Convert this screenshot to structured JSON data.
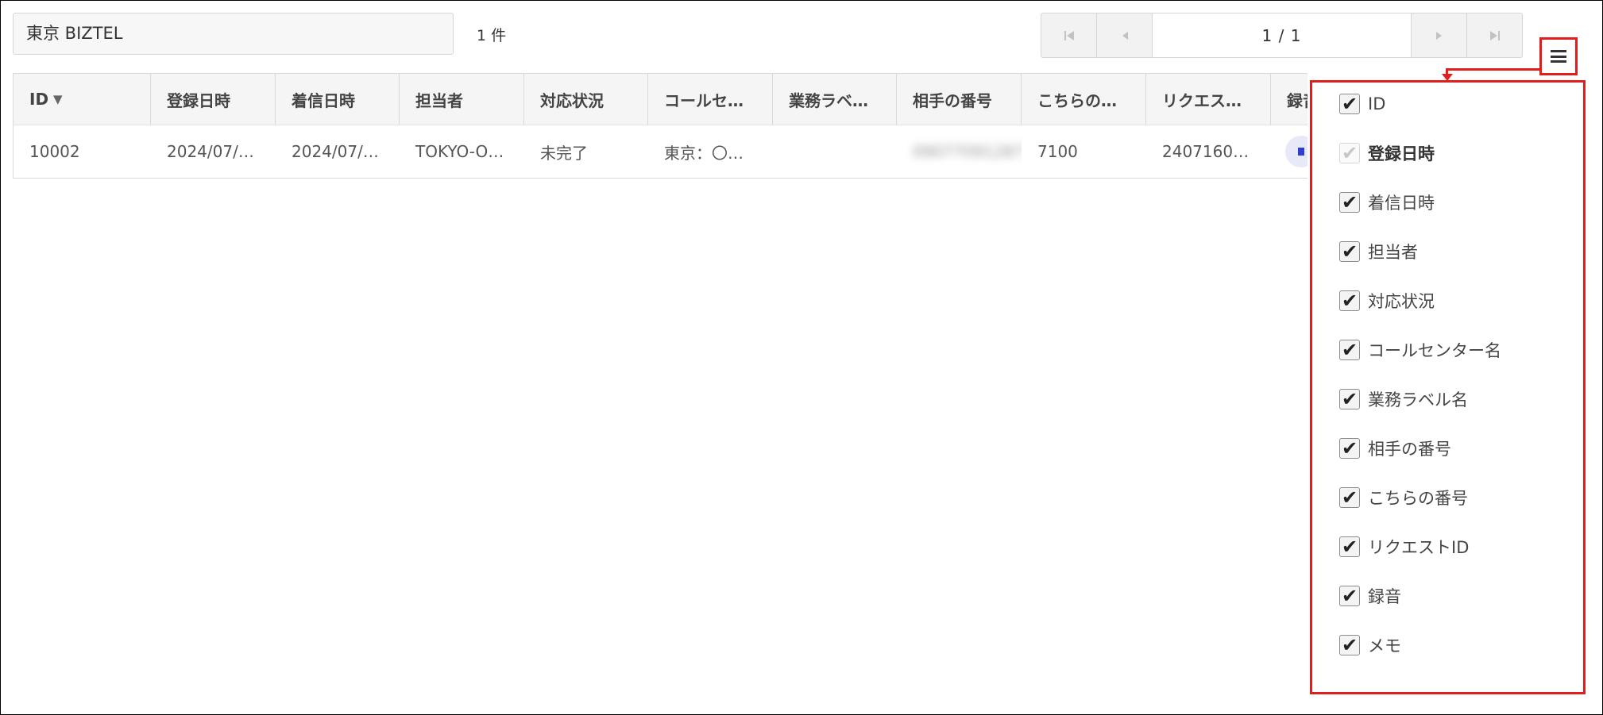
{
  "search": {
    "value": "東京 BIZTEL"
  },
  "result_count": "1 件",
  "pager": {
    "page_info": "1 / 1",
    "first_icon": "first-page-icon",
    "prev_icon": "prev-page-icon",
    "next_icon": "next-page-icon",
    "last_icon": "last-page-icon"
  },
  "table": {
    "columns": [
      "ID",
      "登録日時",
      "着信日時",
      "担当者",
      "対応状況",
      "コールセ…",
      "業務ラベ…",
      "相手の番号",
      "こちらの…",
      "リクエス…",
      "録音"
    ],
    "sort_icon": "sort-desc-icon",
    "rows": [
      {
        "cells": [
          "10002",
          "2024/07/…",
          "2024/07/…",
          "TOKYO-O…",
          "未完了",
          "東京：〇…",
          "",
          "09077091287",
          "7100",
          "2407160…",
          ""
        ]
      }
    ]
  },
  "column_menu": {
    "button_icon": "hamburger-menu-icon",
    "highlight_color": "#e21d1d",
    "items": [
      {
        "label": "ID",
        "checked": true
      },
      {
        "label": "登録日時",
        "checked": true,
        "disabled": true
      },
      {
        "label": "着信日時",
        "checked": true
      },
      {
        "label": "担当者",
        "checked": true
      },
      {
        "label": "対応状況",
        "checked": true
      },
      {
        "label": "コールセンター名",
        "checked": true
      },
      {
        "label": "業務ラベル名",
        "checked": true
      },
      {
        "label": "相手の番号",
        "checked": true
      },
      {
        "label": "こちらの番号",
        "checked": true
      },
      {
        "label": "リクエストID",
        "checked": true
      },
      {
        "label": "録音",
        "checked": true
      },
      {
        "label": "メモ",
        "checked": true
      }
    ]
  }
}
